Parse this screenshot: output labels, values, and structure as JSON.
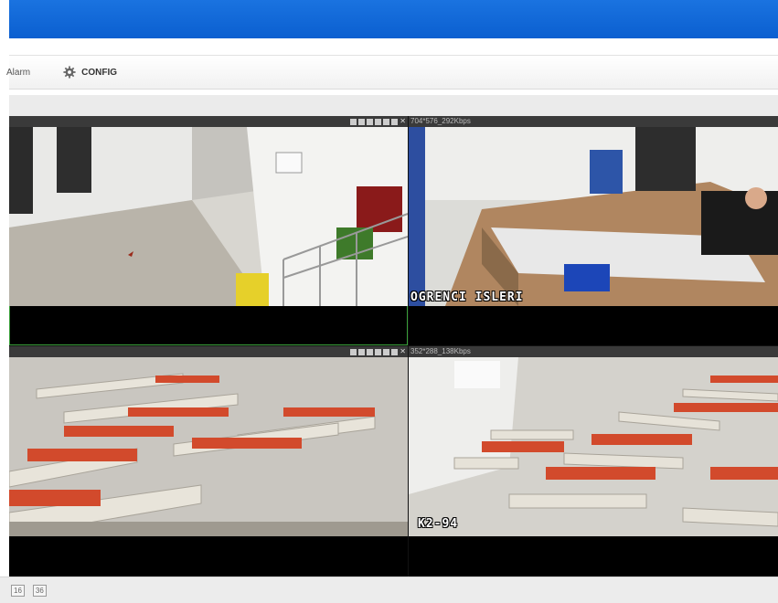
{
  "nav": {
    "alarm_label": "Alarm",
    "config_label": "CONFIG",
    "config_icon": "gear-icon"
  },
  "cameras": [
    {
      "stream": "",
      "overlay": ""
    },
    {
      "stream": "704*576_292Kbps",
      "overlay": "OGRENCI  ISLERI"
    },
    {
      "stream": "352*288_138Kbps",
      "overlay": ""
    },
    {
      "stream": "",
      "overlay": "K2-94"
    }
  ],
  "toolbar_icons": [
    "record-icon",
    "snapshot-icon",
    "zoom-icon",
    "ptz-icon",
    "stream-icon",
    "audio-icon",
    "close-icon"
  ],
  "layout_options": [
    "16",
    "36"
  ],
  "colors": {
    "header": "#0b5fd0",
    "active_border": "#3aa03a"
  }
}
